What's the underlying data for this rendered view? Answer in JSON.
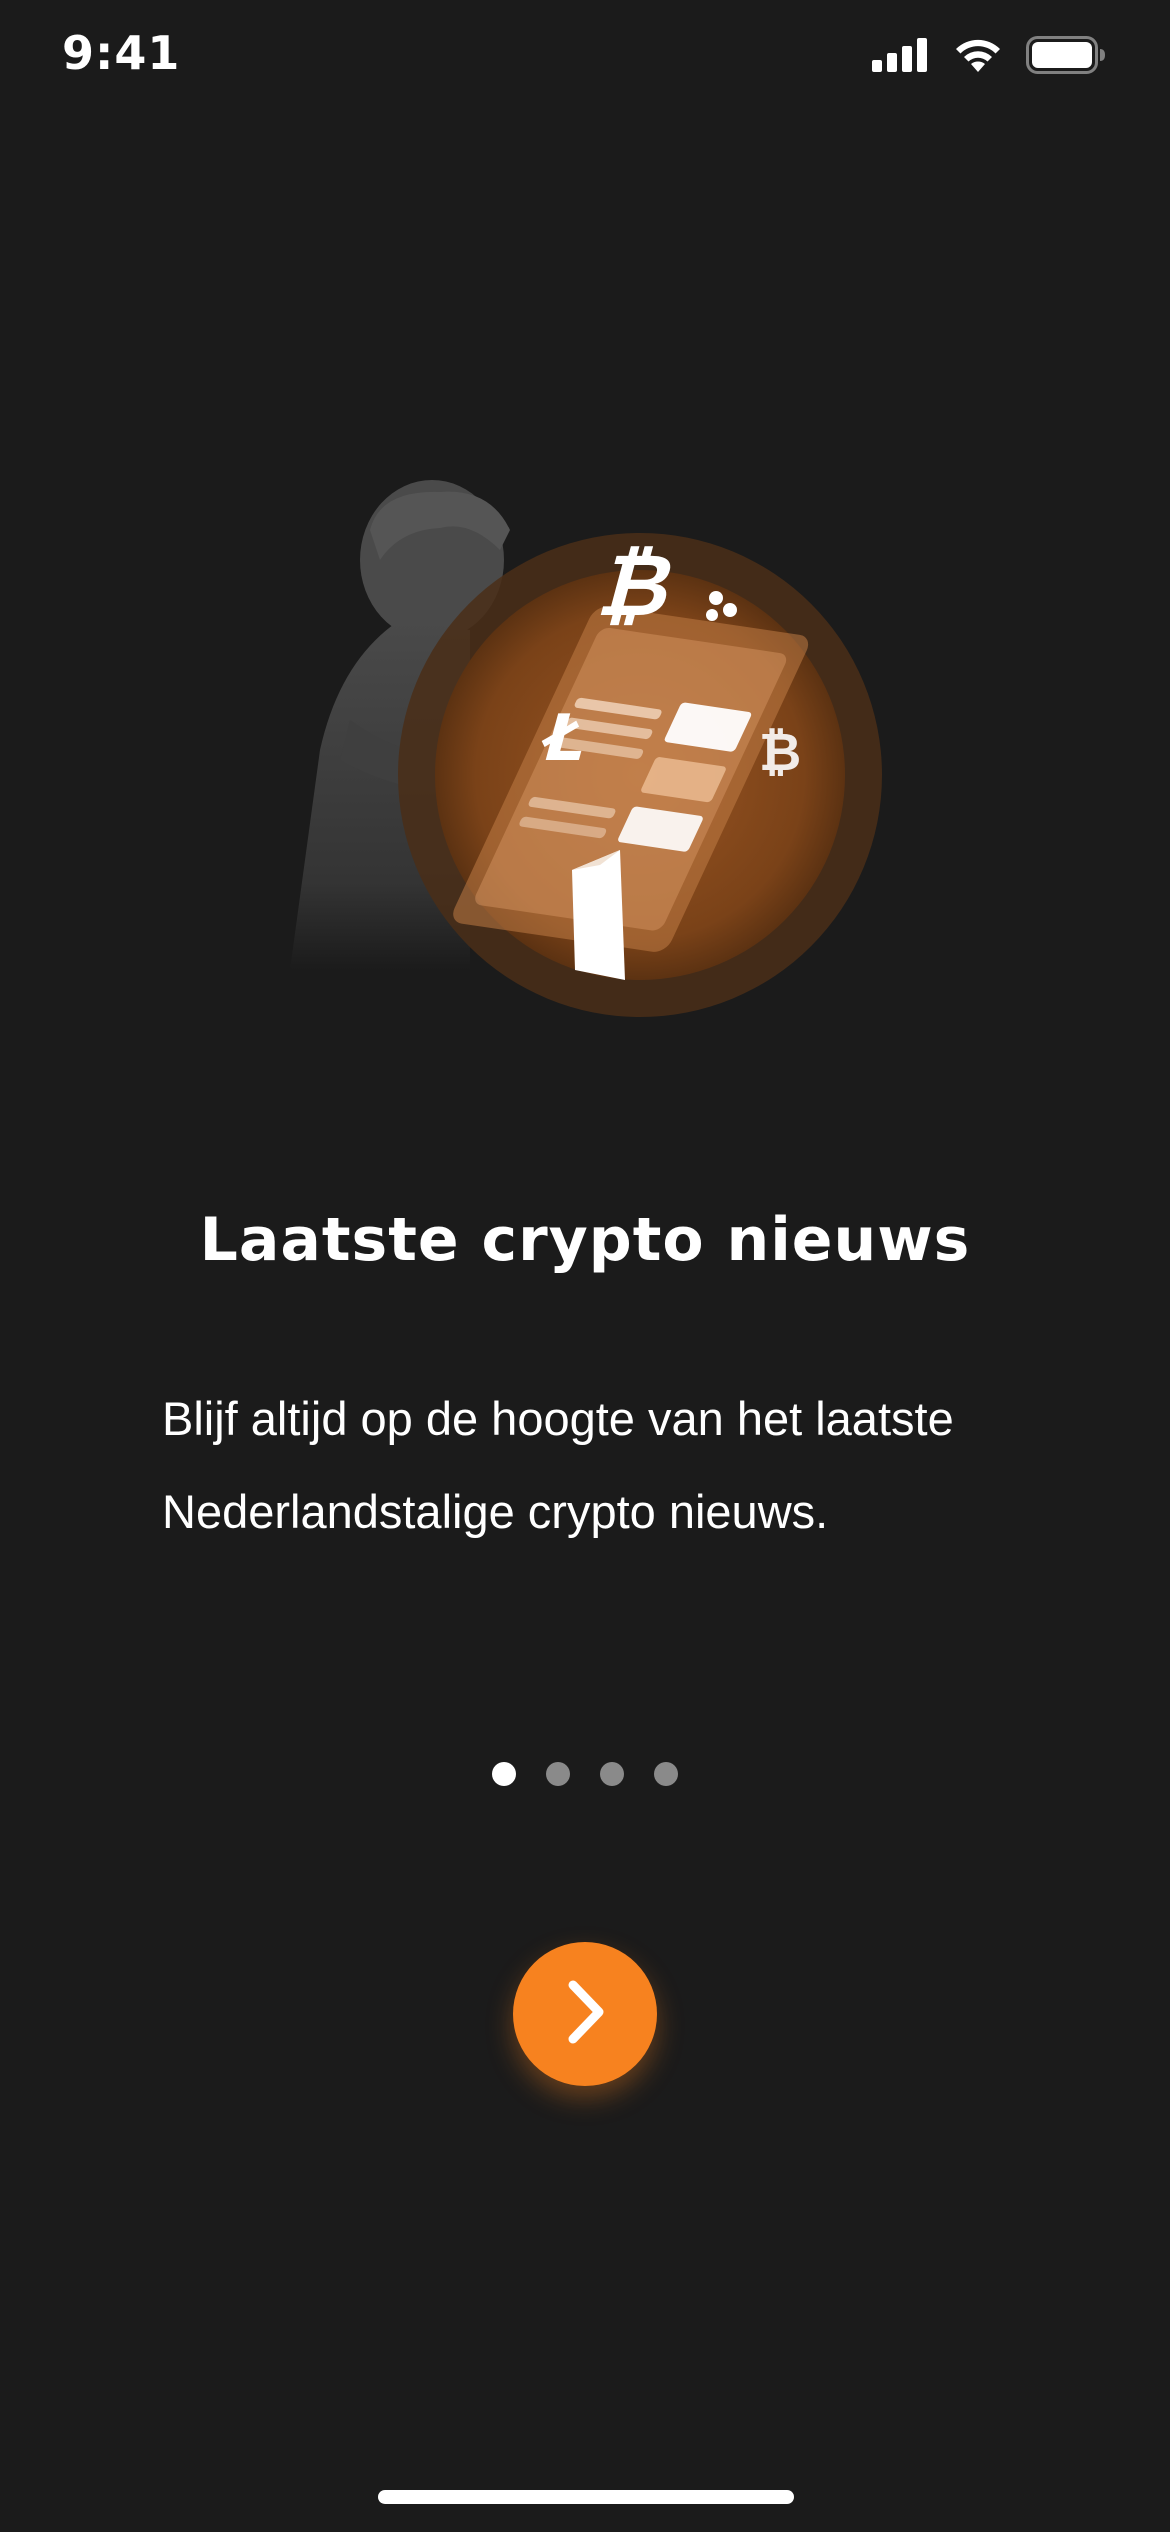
{
  "status_bar": {
    "time": "9:41",
    "icons": [
      "cellular-signal-icon",
      "wifi-icon",
      "battery-icon"
    ]
  },
  "illustration": {
    "name": "crypto-news-illustration",
    "symbols": [
      "bitcoin-icon",
      "litecoin-icon",
      "ripple-icon",
      "ethereum-icon"
    ]
  },
  "onboarding": {
    "title": "Laatste crypto nieuws",
    "description": "Blijf altijd op de hoogte van het laatste Nederlandstalige crypto nieuws."
  },
  "pager": {
    "total": 4,
    "active_index": 0
  },
  "next_button": {
    "icon": "chevron-right-icon"
  },
  "colors": {
    "background": "#1b1b1b",
    "accent": "#f7821f",
    "text": "#ffffff",
    "dot_inactive": "#8a8a8a"
  }
}
